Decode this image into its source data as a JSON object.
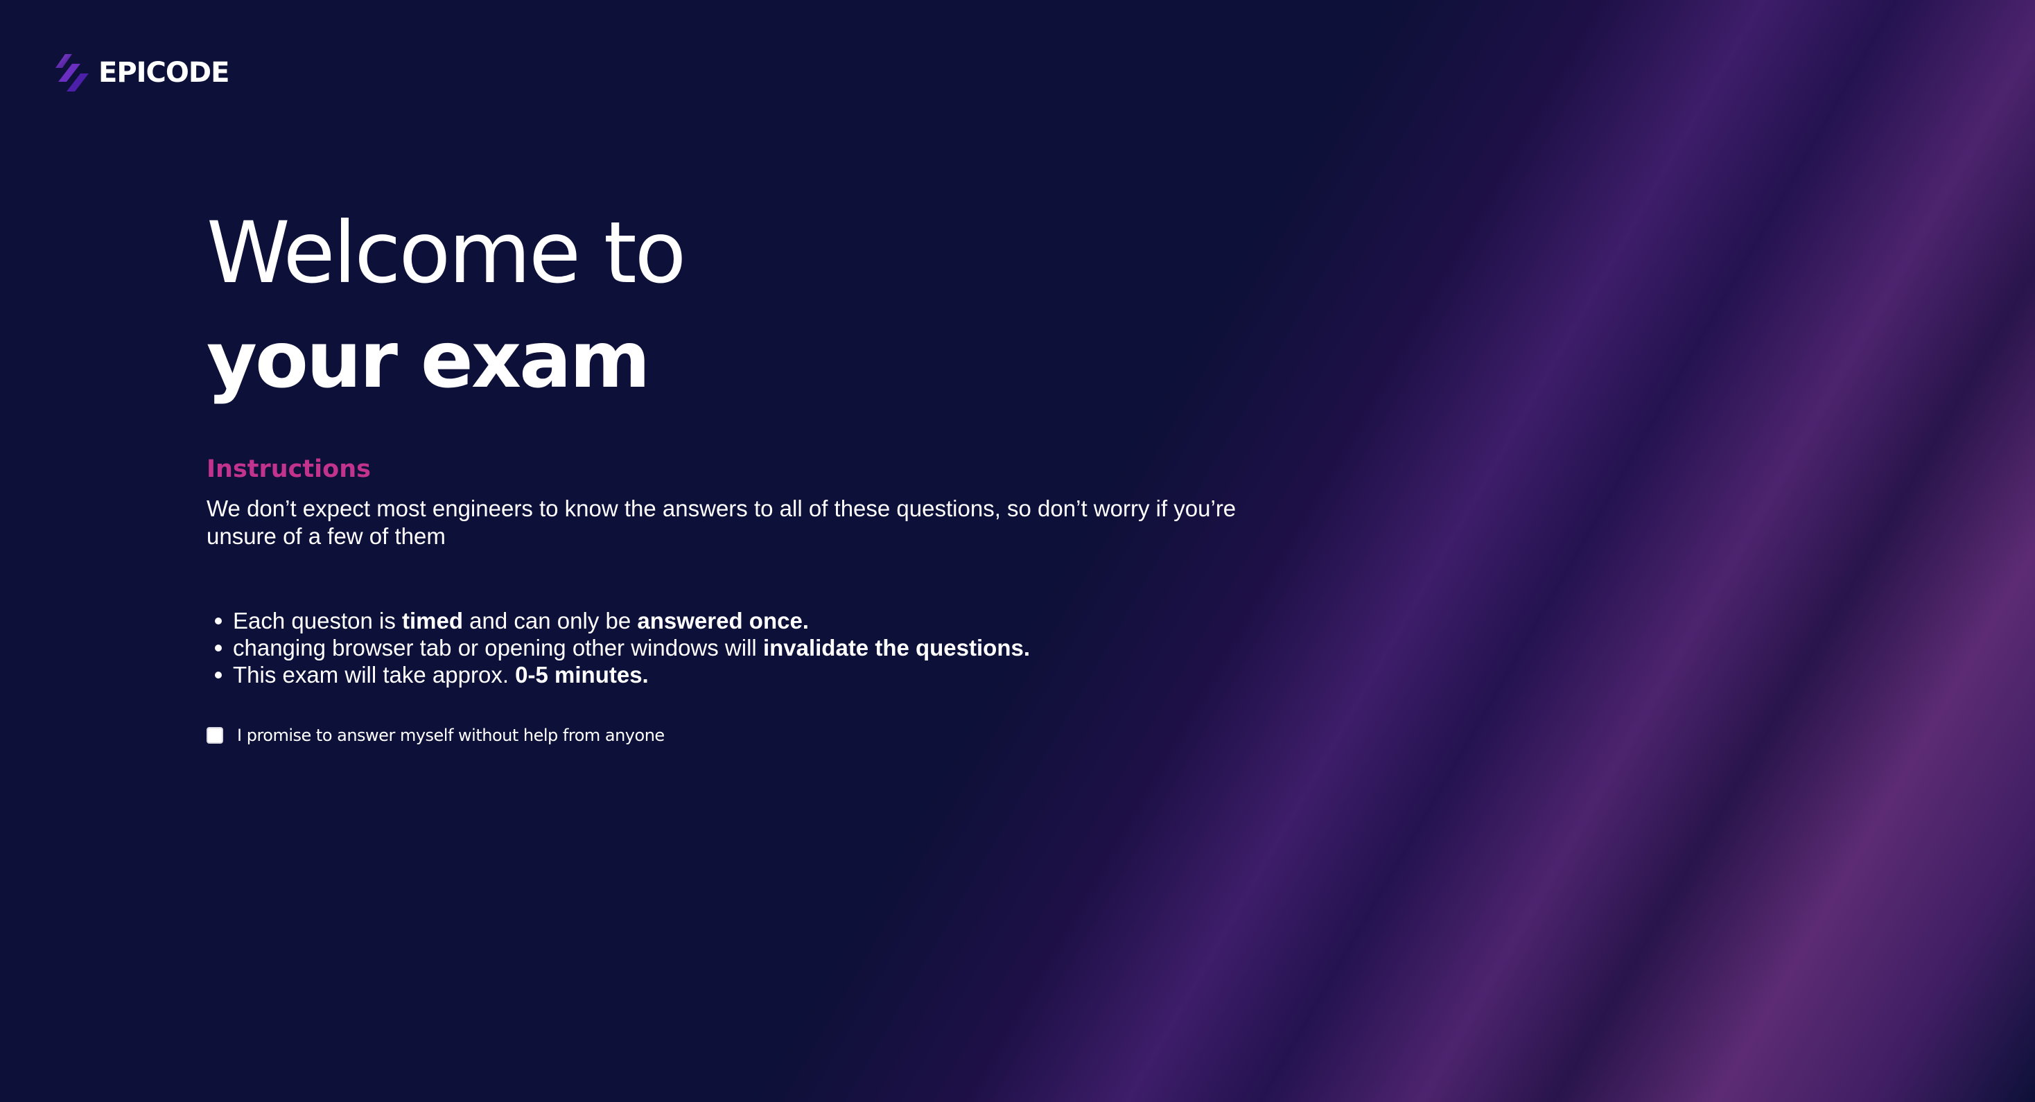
{
  "brand": {
    "logo_icon": "epicode-logo-icon",
    "name": "EPICODE"
  },
  "hero": {
    "title_line1": "Welcome to",
    "title_line2": "your exam"
  },
  "instructions": {
    "heading": "Instructions",
    "intro": "We don’t expect most engineers to know the answers to all of these questions, so don’t worry if you’re unsure of a few of them",
    "rules": [
      {
        "pre": "Each queston is ",
        "b1": "timed",
        "mid": " and can only be ",
        "b2": "answered once."
      },
      {
        "pre": "changing browser tab or opening other windows will ",
        "b1": "invalidate the questions.",
        "mid": "",
        "b2": ""
      },
      {
        "pre": "This exam will take approx. ",
        "b1": "0-5 minutes.",
        "mid": "",
        "b2": ""
      }
    ]
  },
  "promise": {
    "label": "I promise to answer myself without help from anyone",
    "checked": false
  },
  "colors": {
    "background": "#0d1038",
    "accent": "#c1338e",
    "text": "#ffffff"
  }
}
